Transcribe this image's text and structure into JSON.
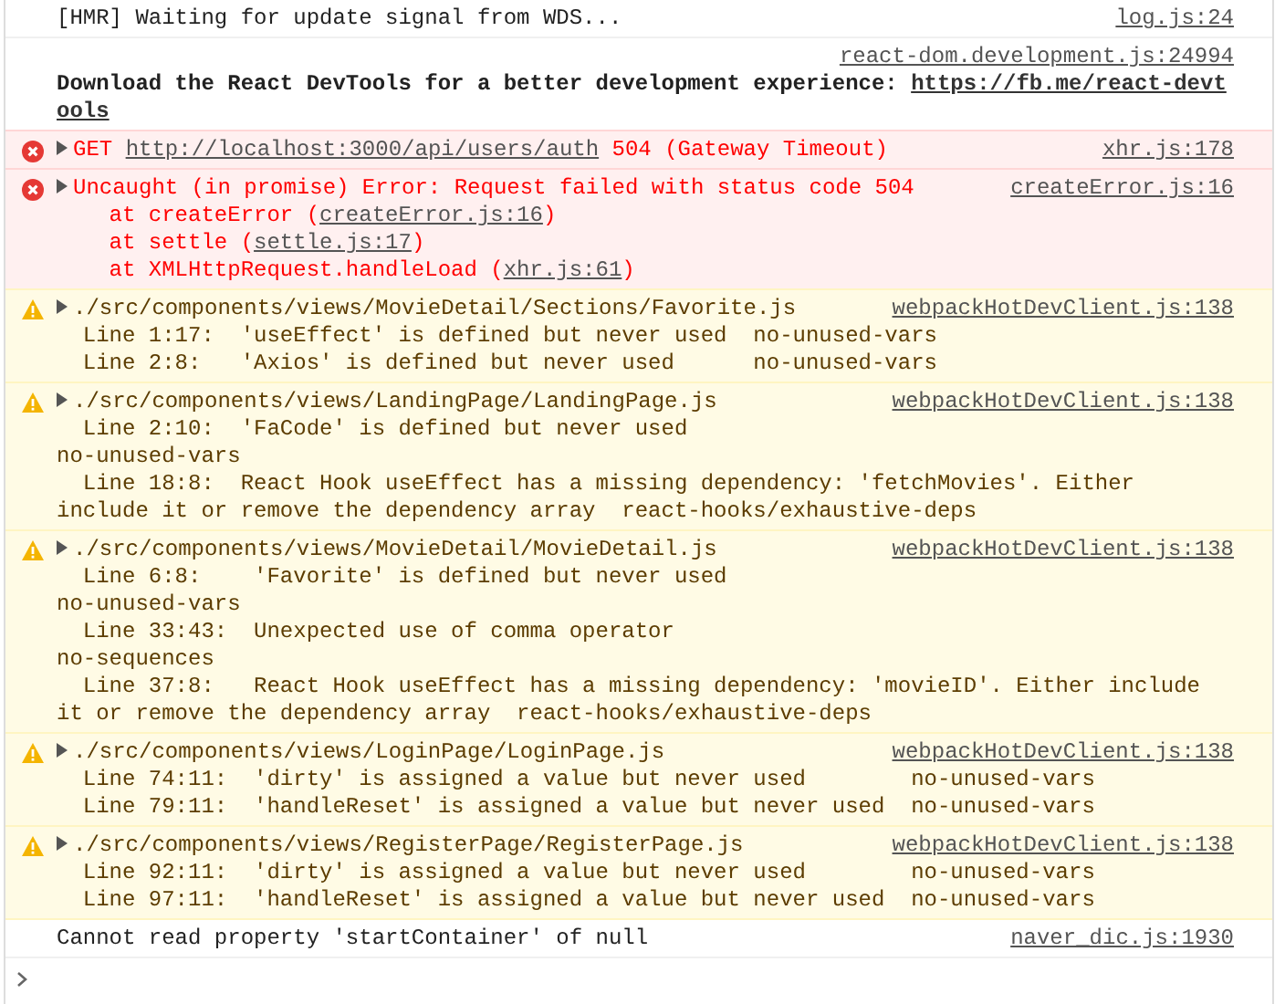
{
  "messages": [
    {
      "kind": "log",
      "source": "log.js:24",
      "lines": [
        {
          "text": "[HMR] Waiting for update signal from WDS..."
        }
      ]
    },
    {
      "kind": "info",
      "source": "react-dom.development.js:24994",
      "lines": [
        {
          "text": "Download the React DevTools for a better development experience: ",
          "link": "https://fb.me/react-devt"
        },
        {
          "link": "ools"
        }
      ]
    },
    {
      "kind": "error",
      "expanded": false,
      "source": "xhr.js:178",
      "lines": [
        {
          "text": "GET ",
          "link": "http://localhost:3000/api/users/auth",
          "after": " 504 (Gateway Timeout)"
        }
      ]
    },
    {
      "kind": "error",
      "expanded": false,
      "source": "createError.js:16",
      "lines": [
        {
          "text": "Uncaught (in promise) Error: Request failed with status code 504"
        },
        {
          "text": "    at createError (",
          "link": "createError.js:16",
          "after": ")"
        },
        {
          "text": "    at settle (",
          "link": "settle.js:17",
          "after": ")"
        },
        {
          "text": "    at XMLHttpRequest.handleLoad (",
          "link": "xhr.js:61",
          "after": ")"
        }
      ]
    },
    {
      "kind": "warning",
      "expanded": false,
      "source": "webpackHotDevClient.js:138",
      "lines": [
        {
          "text": "./src/components/views/MovieDetail/Sections/Favorite.js"
        },
        {
          "text": "  Line 1:17:  'useEffect' is defined but never used  no-unused-vars"
        },
        {
          "text": "  Line 2:8:   'Axios' is defined but never used      no-unused-vars"
        }
      ]
    },
    {
      "kind": "warning",
      "expanded": false,
      "source": "webpackHotDevClient.js:138",
      "lines": [
        {
          "text": "./src/components/views/LandingPage/LandingPage.js"
        },
        {
          "text": "  Line 2:10:  'FaCode' is defined but never used"
        },
        {
          "text": "no-unused-vars"
        },
        {
          "text": "  Line 18:8:  React Hook useEffect has a missing dependency: 'fetchMovies'. Either"
        },
        {
          "text": "include it or remove the dependency array  react-hooks/exhaustive-deps"
        }
      ]
    },
    {
      "kind": "warning",
      "expanded": false,
      "source": "webpackHotDevClient.js:138",
      "lines": [
        {
          "text": "./src/components/views/MovieDetail/MovieDetail.js"
        },
        {
          "text": "  Line 6:8:    'Favorite' is defined but never used"
        },
        {
          "text": "no-unused-vars"
        },
        {
          "text": "  Line 33:43:  Unexpected use of comma operator"
        },
        {
          "text": "no-sequences"
        },
        {
          "text": "  Line 37:8:   React Hook useEffect has a missing dependency: 'movieID'. Either include"
        },
        {
          "text": "it or remove the dependency array  react-hooks/exhaustive-deps"
        }
      ]
    },
    {
      "kind": "warning",
      "expanded": false,
      "source": "webpackHotDevClient.js:138",
      "lines": [
        {
          "text": "./src/components/views/LoginPage/LoginPage.js"
        },
        {
          "text": "  Line 74:11:  'dirty' is assigned a value but never used        no-unused-vars"
        },
        {
          "text": "  Line 79:11:  'handleReset' is assigned a value but never used  no-unused-vars"
        }
      ]
    },
    {
      "kind": "warning",
      "expanded": false,
      "source": "webpackHotDevClient.js:138",
      "lines": [
        {
          "text": "./src/components/views/RegisterPage/RegisterPage.js"
        },
        {
          "text": "  Line 92:11:  'dirty' is assigned a value but never used        no-unused-vars"
        },
        {
          "text": "  Line 97:11:  'handleReset' is assigned a value but never used  no-unused-vars"
        }
      ]
    },
    {
      "kind": "log",
      "source": "naver_dic.js:1930",
      "lines": [
        {
          "text": "Cannot read property 'startContainer' of null"
        }
      ]
    }
  ]
}
